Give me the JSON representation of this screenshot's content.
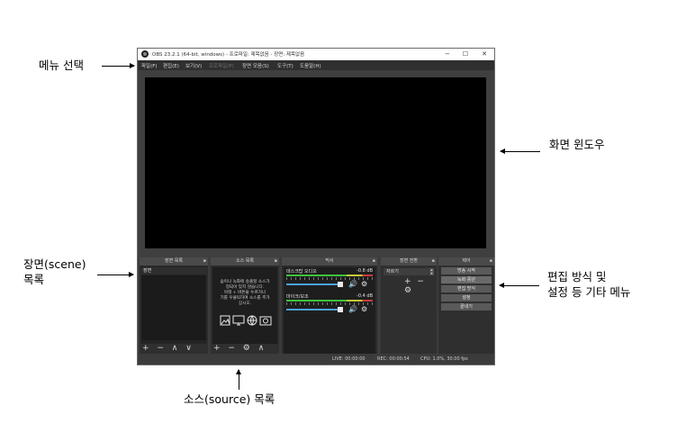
{
  "annotations": {
    "menu": "메뉴 선택",
    "window": "화면 윈도우",
    "scene": [
      "장면(scene)",
      "목록"
    ],
    "settings": [
      "편집 방식 및",
      "설정 등 기타 메뉴"
    ],
    "source": "소스(source) 목록"
  },
  "window": {
    "title": "OBS 23.2.1 (64-bit, windows) - 프로파일: 제목없음 - 장면: 제목없음",
    "controls": [
      "−",
      "☐",
      "✕"
    ]
  },
  "menu": [
    "파일(F)",
    "편집(E)",
    "보기(V)",
    "프로파일(P)",
    "장면 모음(S)",
    "도구(T)",
    "도움말(H)"
  ],
  "docks": {
    "scenes": {
      "title": "장면 목록",
      "items": [
        "장면"
      ],
      "toolbar": "+ − ∧ ∨"
    },
    "sources": {
      "title": "소스 목록",
      "empty": [
        "숨이나 녹화에 송출할 소스가",
        "정되어 있지 않습니다.",
        "아래 + 버튼을 누르거나",
        "기를 우클릭하여 소스를 추가",
        "십시오."
      ],
      "toolbar": "+ − ⚙ ∧ ∨"
    },
    "mixer": {
      "title": "믹서",
      "channels": [
        {
          "name": "데스크탑 오디오",
          "db": "-0.8 dB"
        },
        {
          "name": "마이크/보조",
          "db": "-0.4 dB"
        }
      ]
    },
    "transitions": {
      "title": "장면 전환",
      "selected": "자르기",
      "toolbar": "+ − ⚙"
    },
    "controls": {
      "title": "제어",
      "buttons": [
        "방송 시작",
        "녹화 중단",
        "편집 방식",
        "설정",
        "끝내기"
      ]
    }
  },
  "status": {
    "live": "LIVE: 00:00:00",
    "rec": "REC: 00:00:54",
    "cpu": "CPU: 1.0%, 30.00 fps"
  },
  "colors": {
    "accent": "#4aa3df",
    "meter_green": "#3cc43c",
    "window_bg": "#3b3b3b"
  }
}
